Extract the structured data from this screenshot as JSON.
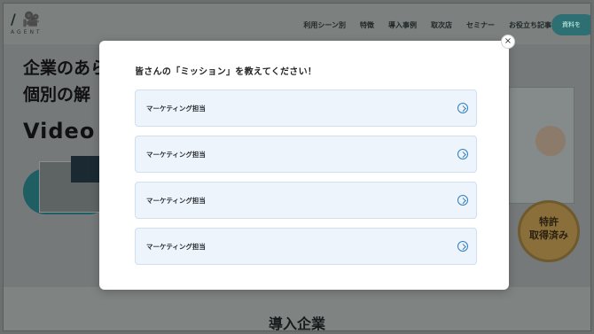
{
  "header": {
    "logo_mark": "/ 🎥",
    "logo_sub": "AGENT",
    "nav": [
      "利用シーン別",
      "特徴",
      "導入事例",
      "取次店",
      "セミナー",
      "お役立ち記事"
    ],
    "cta_label": "資料を"
  },
  "hero": {
    "line1": "企業のあら",
    "line2": "個別の解",
    "line3": "Video"
  },
  "patent_badge": "特許\n取得済み",
  "lower_section_title": "導入企業",
  "modal": {
    "title": "皆さんの「ミッション」を教えてください！",
    "close_label": "×",
    "options": [
      {
        "label": "マーケティング担当"
      },
      {
        "label": "マーケティング担当"
      },
      {
        "label": "マーケティング担当"
      },
      {
        "label": "マーケティング担当"
      }
    ]
  }
}
